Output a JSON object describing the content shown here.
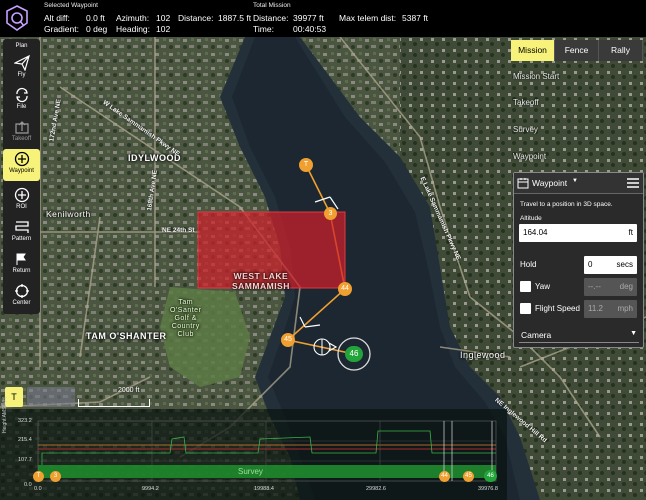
{
  "telemetry": {
    "selected_header": "Selected Waypoint",
    "total_header": "Total Mission",
    "alt_diff_label": "Alt diff:",
    "alt_diff_value": "0.0 ft",
    "gradient_label": "Gradient:",
    "gradient_value": "0 deg",
    "azimuth_label": "Azimuth:",
    "azimuth_value": "102",
    "heading_label": "Heading:",
    "heading_value": "102",
    "distance_label": "Distance:",
    "distance_value": "1887.5 ft",
    "total_distance_label": "Distance:",
    "total_distance_value": "39977 ft",
    "time_label": "Time:",
    "time_value": "00:40:53",
    "telem_label": "Max telem dist:",
    "telem_value": "5387 ft"
  },
  "toolbar": {
    "items": [
      {
        "label": "Plan",
        "icon": "plan-icon"
      },
      {
        "label": "Fly",
        "icon": "paper-plane-icon"
      },
      {
        "label": "File",
        "icon": "sync-icon"
      },
      {
        "label": "Takeoff",
        "icon": "takeoff-icon"
      },
      {
        "label": "Waypoint",
        "icon": "plus-circle-icon"
      },
      {
        "label": "ROI",
        "icon": "plus-circle-icon"
      },
      {
        "label": "Pattern",
        "icon": "pattern-icon"
      },
      {
        "label": "Return",
        "icon": "return-icon"
      },
      {
        "label": "Center",
        "icon": "center-icon"
      }
    ]
  },
  "tabs": {
    "mission": "Mission",
    "fence": "Fence",
    "rally": "Rally"
  },
  "mission_list": {
    "start": "Mission Start",
    "takeoff": "Takeoff",
    "survey": "Survey",
    "waypoint": "Waypoint"
  },
  "waypoint_card": {
    "title": "Waypoint",
    "description": "Travel to a position in 3D space.",
    "altitude_label": "Altitude",
    "altitude_value": "164.04",
    "altitude_unit": "ft",
    "hold_label": "Hold",
    "hold_value": "0",
    "hold_unit": "secs",
    "yaw_label": "Yaw",
    "yaw_value": "--.--",
    "yaw_unit": "deg",
    "speed_label": "Flight Speed",
    "speed_value": "11.2",
    "speed_unit": "mph",
    "camera_label": "Camera"
  },
  "map": {
    "neighborhoods": [
      "IDYLWOOD",
      "Kenilworth",
      "TAM O'SHANTER",
      "Inglewood"
    ],
    "park_label": "WEST LAKE\nSAMMAMISH",
    "golf_label": "Tam\nO'Santer\nGolf &\nCountry\nClub",
    "roads": [
      "W Lake Sammamish Pkwy NE",
      "172nd Ave NE",
      "168th Ave NE",
      "NE 24th St",
      "E Lake Sammamish Pkwy NE",
      "NE Inglewood Hill Rd"
    ],
    "scale_label": "2000 ft",
    "waypoints": [
      {
        "label": "T",
        "color": "#f0a030"
      },
      {
        "label": "3",
        "color": "#f0a030"
      },
      {
        "label": "44",
        "color": "#f0a030"
      },
      {
        "label": "45",
        "color": "#f0a030"
      },
      {
        "label": "46",
        "color": "#22a43a"
      }
    ]
  },
  "elevation": {
    "y_axis_label": "Height AMSL (ft)",
    "y_ticks": [
      "323.2",
      "215.4",
      "107.7",
      "0.0"
    ],
    "x_ticks": [
      "0.0",
      "9994.2",
      "19988.4",
      "29982.6",
      "39976.8"
    ],
    "survey_label": "Survey",
    "markers": [
      "T",
      "3",
      "44",
      "45",
      "46"
    ],
    "takeoff_marker": "T"
  },
  "colors": {
    "accent": "#f6f27a",
    "waypoint": "#f0a030",
    "active_wp": "#22a43a",
    "survey_poly": "#d0202a"
  }
}
